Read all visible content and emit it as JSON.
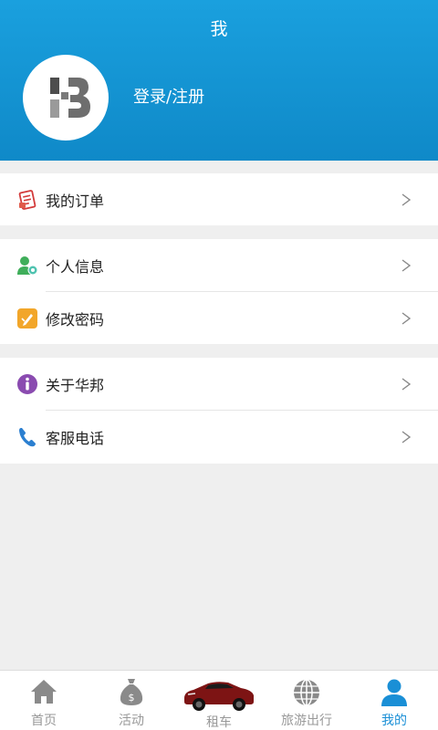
{
  "header": {
    "title": "我",
    "login_label": "登录/注册",
    "colors": {
      "bg_top": "#1aa0de",
      "bg_bottom": "#0f89c8"
    }
  },
  "menu": {
    "groups": [
      {
        "items": [
          {
            "label": "我的订单",
            "icon": "orders-icon"
          }
        ]
      },
      {
        "items": [
          {
            "label": "个人信息",
            "icon": "personal-info-icon"
          },
          {
            "label": "修改密码",
            "icon": "change-password-icon"
          }
        ]
      },
      {
        "items": [
          {
            "label": "关于华邦",
            "icon": "info-icon"
          },
          {
            "label": "客服电话",
            "icon": "phone-icon"
          }
        ]
      }
    ]
  },
  "tabbar": {
    "tabs": [
      {
        "label": "首页",
        "icon": "home-icon"
      },
      {
        "label": "活动",
        "icon": "money-bag-icon"
      },
      {
        "label": "租车",
        "icon": "car-icon"
      },
      {
        "label": "旅游出行",
        "icon": "globe-icon"
      },
      {
        "label": "我的",
        "icon": "user-icon"
      }
    ],
    "active_index": 4,
    "active_color": "#1a8fd6"
  }
}
